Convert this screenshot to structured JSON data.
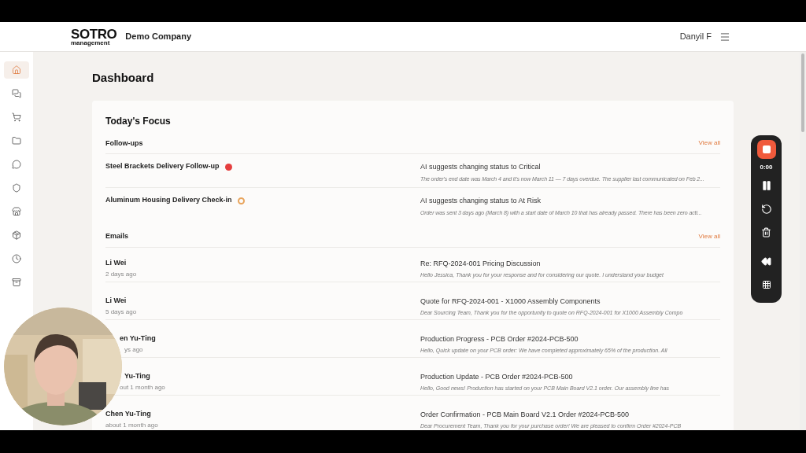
{
  "header": {
    "logo": "SOTRO",
    "logo_sub": "management",
    "company": "Demo Company",
    "user": "Danyil F"
  },
  "sidebar": {
    "items": [
      {
        "selected": true
      },
      {
        "selected": false
      },
      {
        "selected": false
      },
      {
        "selected": false
      },
      {
        "selected": false
      },
      {
        "selected": false
      },
      {
        "selected": false
      },
      {
        "selected": false
      },
      {
        "selected": false
      },
      {
        "selected": false
      }
    ]
  },
  "page_title": "Dashboard",
  "focus": {
    "title": "Today's Focus",
    "followups": {
      "title": "Follow-ups",
      "view_all": "View all",
      "items": [
        {
          "title": "Steel Brackets Delivery Follow-up",
          "color": "#e53e3e",
          "kind": "filled",
          "suggestion": "AI suggests changing status to Critical",
          "detail": "The order's end date was March 4 and it's now March 11 — 7 days overdue. The supplier last communicated on Feb 2..."
        },
        {
          "title": "Aluminum Housing Delivery Check-in",
          "color": "#e8a45c",
          "kind": "ring",
          "suggestion": "AI suggests changing status to At Risk",
          "detail": "Order was sent 3 days ago (March 8) with a start date of March 10 that has already passed. There has been zero acti..."
        }
      ]
    },
    "emails": {
      "title": "Emails",
      "view_all": "View all",
      "items": [
        {
          "sender": "Li Wei",
          "time": "2 days ago",
          "subject": "Re: RFQ-2024-001 Pricing Discussion",
          "preview": "Hello Jessica, Thank you for your response and for considering our quote. I understand your budget"
        },
        {
          "sender": "Li Wei",
          "time": "5 days ago",
          "subject": "Quote for RFQ-2024-001 - X1000 Assembly Components",
          "preview": "Dear Sourcing Team, Thank you for the opportunity to quote on RFQ-2024-001 for X1000 Assembly Compo"
        },
        {
          "sender": "en Yu-Ting",
          "time": "ys ago",
          "subject": "Production Progress - PCB Order #2024-PCB-500",
          "preview": "Hello, Quick update on your PCB order: We have completed approximately 65% of the production. All"
        },
        {
          "sender": "Yu-Ting",
          "time": "out 1 month ago",
          "subject": "Production Update - PCB Order #2024-PCB-500",
          "preview": "Hello, Good news! Production has started on your PCB Main Board V2.1 order. Our assembly line has"
        },
        {
          "sender": "Chen Yu-Ting",
          "time": "about 1 month ago",
          "subject": "Order Confirmation - PCB Main Board V2.1 Order #2024-PCB-500",
          "preview": "Dear Procurement Team, Thank you for your purchase order! We are pleased to confirm Order #2024-PCB"
        }
      ]
    }
  },
  "recorder": {
    "time": "0:00"
  }
}
